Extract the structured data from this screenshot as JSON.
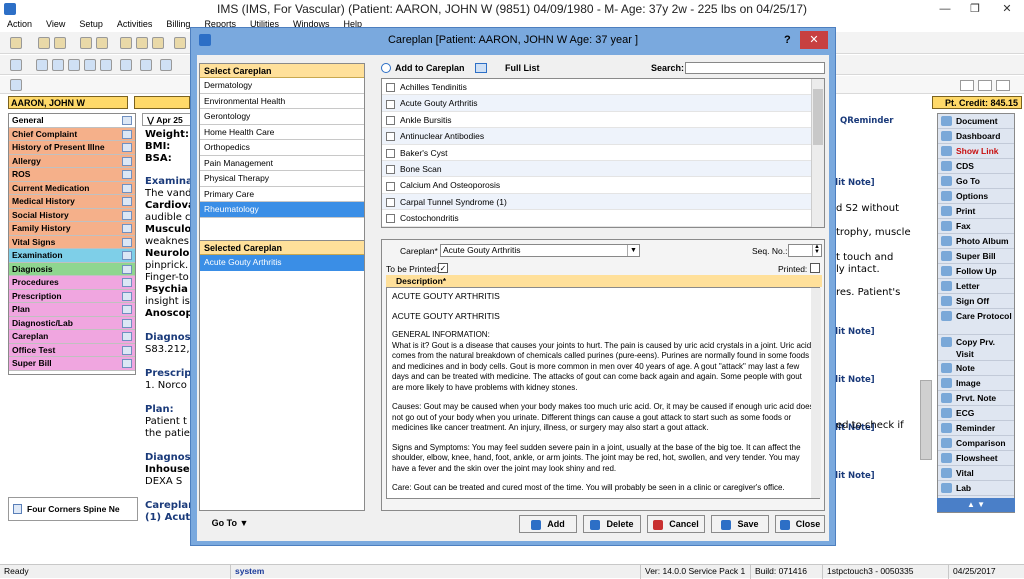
{
  "window": {
    "title": "IMS (IMS, For Vascular)    (Patient: AARON, JOHN W (9851) 04/09/1980 - M- Age: 37y 2w  - 225 lbs on 04/25/17)"
  },
  "menu": [
    "Action",
    "View",
    "Setup",
    "Activities",
    "Billing",
    "Reports",
    "Utilities",
    "Windows",
    "Help"
  ],
  "patient_bar": {
    "name": "AARON, JOHN W",
    "credit": "Pt. Credit: 845.15",
    "date_tab": "Apr 25"
  },
  "left_nav": [
    {
      "label": "General",
      "color": "#ffffff"
    },
    {
      "label": "Chief Complaint",
      "color": "#f5b08a"
    },
    {
      "label": "History of Present Illne",
      "color": "#f5b08a"
    },
    {
      "label": "Allergy",
      "color": "#f5b08a"
    },
    {
      "label": "ROS",
      "color": "#f5b08a"
    },
    {
      "label": "Current Medication",
      "color": "#f5b08a"
    },
    {
      "label": "Medical History",
      "color": "#f5b08a"
    },
    {
      "label": "Social History",
      "color": "#f5b08a"
    },
    {
      "label": "Family History",
      "color": "#f5b08a"
    },
    {
      "label": "Vital Signs",
      "color": "#f5b08a"
    },
    {
      "label": "Examination",
      "color": "#7ecfe8"
    },
    {
      "label": "Diagnosis",
      "color": "#8fd68f"
    },
    {
      "label": "Procedures",
      "color": "#f0a6e0"
    },
    {
      "label": "Prescription",
      "color": "#f0a6e0"
    },
    {
      "label": "Plan",
      "color": "#f0a6e0"
    },
    {
      "label": "Diagnostic/Lab",
      "color": "#f0a6e0"
    },
    {
      "label": "Careplan",
      "color": "#f0a6e0"
    },
    {
      "label": "Office Test",
      "color": "#f0a6e0"
    },
    {
      "label": "Super Bill",
      "color": "#f0a6e0"
    }
  ],
  "left_footer": "Four Corners Spine Ne",
  "right_nav": [
    "Document",
    "Dashboard",
    "Show Link",
    "CDS",
    "Go To",
    "Options",
    "Print",
    "Fax",
    "Photo Album",
    "Super Bill",
    "Follow Up",
    "Letter",
    "Sign Off",
    "Care Protocol",
    "Copy Prv. Visit",
    "Note",
    "Image",
    "Prvt. Note",
    "ECG",
    "Reminder",
    "Comparison",
    "Flowsheet",
    "Vital",
    "Lab"
  ],
  "background": {
    "lines": [
      "Weight:",
      "BMI:",
      "BSA:",
      "Examina",
      "The vand",
      "Cardiova",
      "audible c",
      "Musculo",
      "weaknes",
      "Neurolo",
      "pinprick.",
      "Finger-to",
      "Psychia",
      "insight is",
      "Anoscop",
      "Diagnos",
      "S83.212,",
      "Prescrip",
      "1. Norco",
      "Plan:",
      "Patient t",
      "the patie",
      "Diagnos",
      "Inhouse",
      "DEXA S",
      "Careplan",
      "(1) Acut"
    ],
    "right_lines": [
      "QReminder",
      "dit Note]",
      "d S2 without",
      "trophy, muscle",
      "t touch and",
      "ly intact.",
      "res. Patient's",
      "dit Note]",
      "dit Note]",
      "dit Note]",
      "ed to check if",
      "dit Note]"
    ]
  },
  "dialog": {
    "title": "Careplan  [Patient: AARON, JOHN W  Age: 37 year ]",
    "select_header": "Select Careplan",
    "careplans": [
      "Dermatology",
      "Environmental Health",
      "Gerontology",
      "Home Health Care",
      "Orthopedics",
      "Pain Management",
      "Physical Therapy",
      "Primary Care",
      "Rheumatology"
    ],
    "selected_careplan_index": 8,
    "add_label": "Add to Careplan",
    "full_list_label": "Full List",
    "search_label": "Search:",
    "conditions": [
      "Achilles Tendinitis",
      "Acute Gouty Arthritis",
      "Ankle Bursitis",
      "Antinuclear Antibodies",
      "Baker's Cyst",
      "Bone Scan",
      "Calcium And Osteoporosis",
      "Carpal Tunnel Syndrome (1)",
      "Costochondritis"
    ],
    "selected_header": "Selected Careplan",
    "selected_items": [
      "Acute Gouty Arthritis"
    ],
    "careplan_label": "Careplan*",
    "careplan_value": "Acute Gouty Arthritis",
    "seq_label": "Seq. No.:",
    "to_be_printed": "To be Printed:",
    "printed": "Printed:",
    "description_label": "Description*",
    "description": [
      "ACUTE GOUTY ARTHRITIS",
      "ACUTE GOUTY ARTHRITIS",
      "GENERAL INFORMATION:\nWhat is it?  Gout is a disease that causes your joints to hurt. The pain is caused by uric acid crystals in a joint. Uric acid comes from the natural breakdown of chemicals called purines (pure-eens). Purines are normally found in some foods and medicines and in body cells. Gout is more common in men over 40 years of age. A gout \"attack\" may last a few days and can be treated with medicine. The attacks of gout can come back again and again. Some people with gout are more likely to have problems with kidney stones.",
      "Causes:  Gout may be caused when your body makes too much uric acid. Or, it may be caused if enough uric acid does not go out of your body when you urinate. Different things can cause a gout attack to start such as some foods or medicines like cancer treatment. An injury, illness, or surgery may also start a gout attack.",
      "Signs and Symptoms:  You may feel sudden severe pain in a joint, usually at the base of the big toe. It can affect the shoulder, elbow, knee, hand, foot, ankle, or arm joints. The joint may be red, hot, swollen, and very tender. You may have a fever and the skin over the joint may look shiny and red.",
      "Care:  Gout can be treated and cured most of the time. You will probably be seen in a clinic or caregiver's office."
    ],
    "goto_label": "Go To",
    "buttons": {
      "add": "Add",
      "delete": "Delete",
      "cancel": "Cancel",
      "save": "Save",
      "close": "Close"
    }
  },
  "status": {
    "ready": "Ready",
    "user": "system",
    "version": "Ver: 14.0.0 Service Pack 1",
    "build": "Build: 071416",
    "server": "1stpctouch3 - 0050335",
    "date": "04/25/2017"
  }
}
